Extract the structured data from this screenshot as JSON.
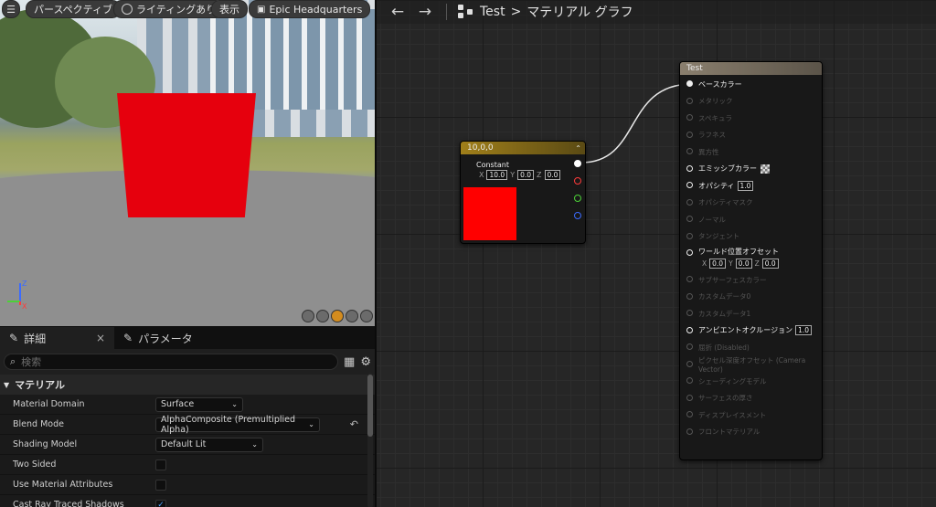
{
  "viewport": {
    "buttons": [
      {
        "label": "パースペクティブ",
        "icon": "perspective-icon"
      },
      {
        "label": "ライティングあり",
        "icon": "lighting-icon"
      },
      {
        "label": "表示",
        "icon": ""
      },
      {
        "label": "Epic Headquarters",
        "icon": "environment-icon"
      }
    ],
    "plane_color": "#e6000d",
    "axis": {
      "z": "Z",
      "x": "X"
    }
  },
  "details": {
    "tabs": [
      {
        "label": "詳細",
        "close": "×"
      },
      {
        "label": "パラメータ"
      }
    ],
    "search_placeholder": "検索",
    "section": "マテリアル",
    "properties": [
      {
        "label": "Material Domain",
        "type": "combo",
        "value": "Surface"
      },
      {
        "label": "Blend Mode",
        "type": "combo",
        "value": "AlphaComposite (Premultiplied Alpha)",
        "reset": true
      },
      {
        "label": "Shading Model",
        "type": "combo",
        "value": "Default Lit"
      },
      {
        "label": "Two Sided",
        "type": "check",
        "checked": false
      },
      {
        "label": "Use Material Attributes",
        "type": "check",
        "checked": false
      },
      {
        "label": "Cast Ray Traced Shadows",
        "type": "check",
        "checked": true
      }
    ]
  },
  "graph": {
    "breadcrumb": {
      "root": "Test",
      "separator": ">",
      "current": "マテリアル グラフ"
    },
    "constant_node": {
      "title": "10,0,0",
      "label": "Constant",
      "values": {
        "x": "10.0",
        "y": "0.0",
        "z": "0.0"
      },
      "swatch": "#ff0000",
      "pins": [
        "#ffffff",
        "#ff3b3b",
        "#4cd137",
        "#3b6bff"
      ]
    },
    "result_node": {
      "title": "Test",
      "pins": [
        {
          "label": "ベースカラー",
          "on": true,
          "connected": true
        },
        {
          "label": "メタリック",
          "on": false
        },
        {
          "label": "スペキュラ",
          "on": false
        },
        {
          "label": "ラフネス",
          "on": false
        },
        {
          "label": "異方性",
          "on": false
        },
        {
          "label": "エミッシブカラー",
          "on": true,
          "checker": true
        },
        {
          "label": "オパシティ",
          "on": true,
          "value": "1.0"
        },
        {
          "label": "オパシティマスク",
          "on": false
        },
        {
          "label": "ノーマル",
          "on": false
        },
        {
          "label": "タンジェント",
          "on": false
        },
        {
          "label": "ワールド位置オフセット",
          "on": true,
          "xyz": {
            "x": "0.0",
            "y": "0.0",
            "z": "0.0"
          }
        },
        {
          "label": "サブサーフェスカラー",
          "on": false
        },
        {
          "label": "カスタムデータ0",
          "on": false
        },
        {
          "label": "カスタムデータ1",
          "on": false
        },
        {
          "label": "アンビエントオクルージョン",
          "on": true,
          "value": "1.0"
        },
        {
          "label": "屈折 (Disabled)",
          "on": false
        },
        {
          "label": "ピクセル深度オフセット (Camera Vector)",
          "on": false
        },
        {
          "label": "シェーディングモデル",
          "on": false
        },
        {
          "label": "サーフェスの厚さ",
          "on": false
        },
        {
          "label": "ディスプレイスメント",
          "on": false
        },
        {
          "label": "フロントマテリアル",
          "on": false
        }
      ]
    }
  }
}
